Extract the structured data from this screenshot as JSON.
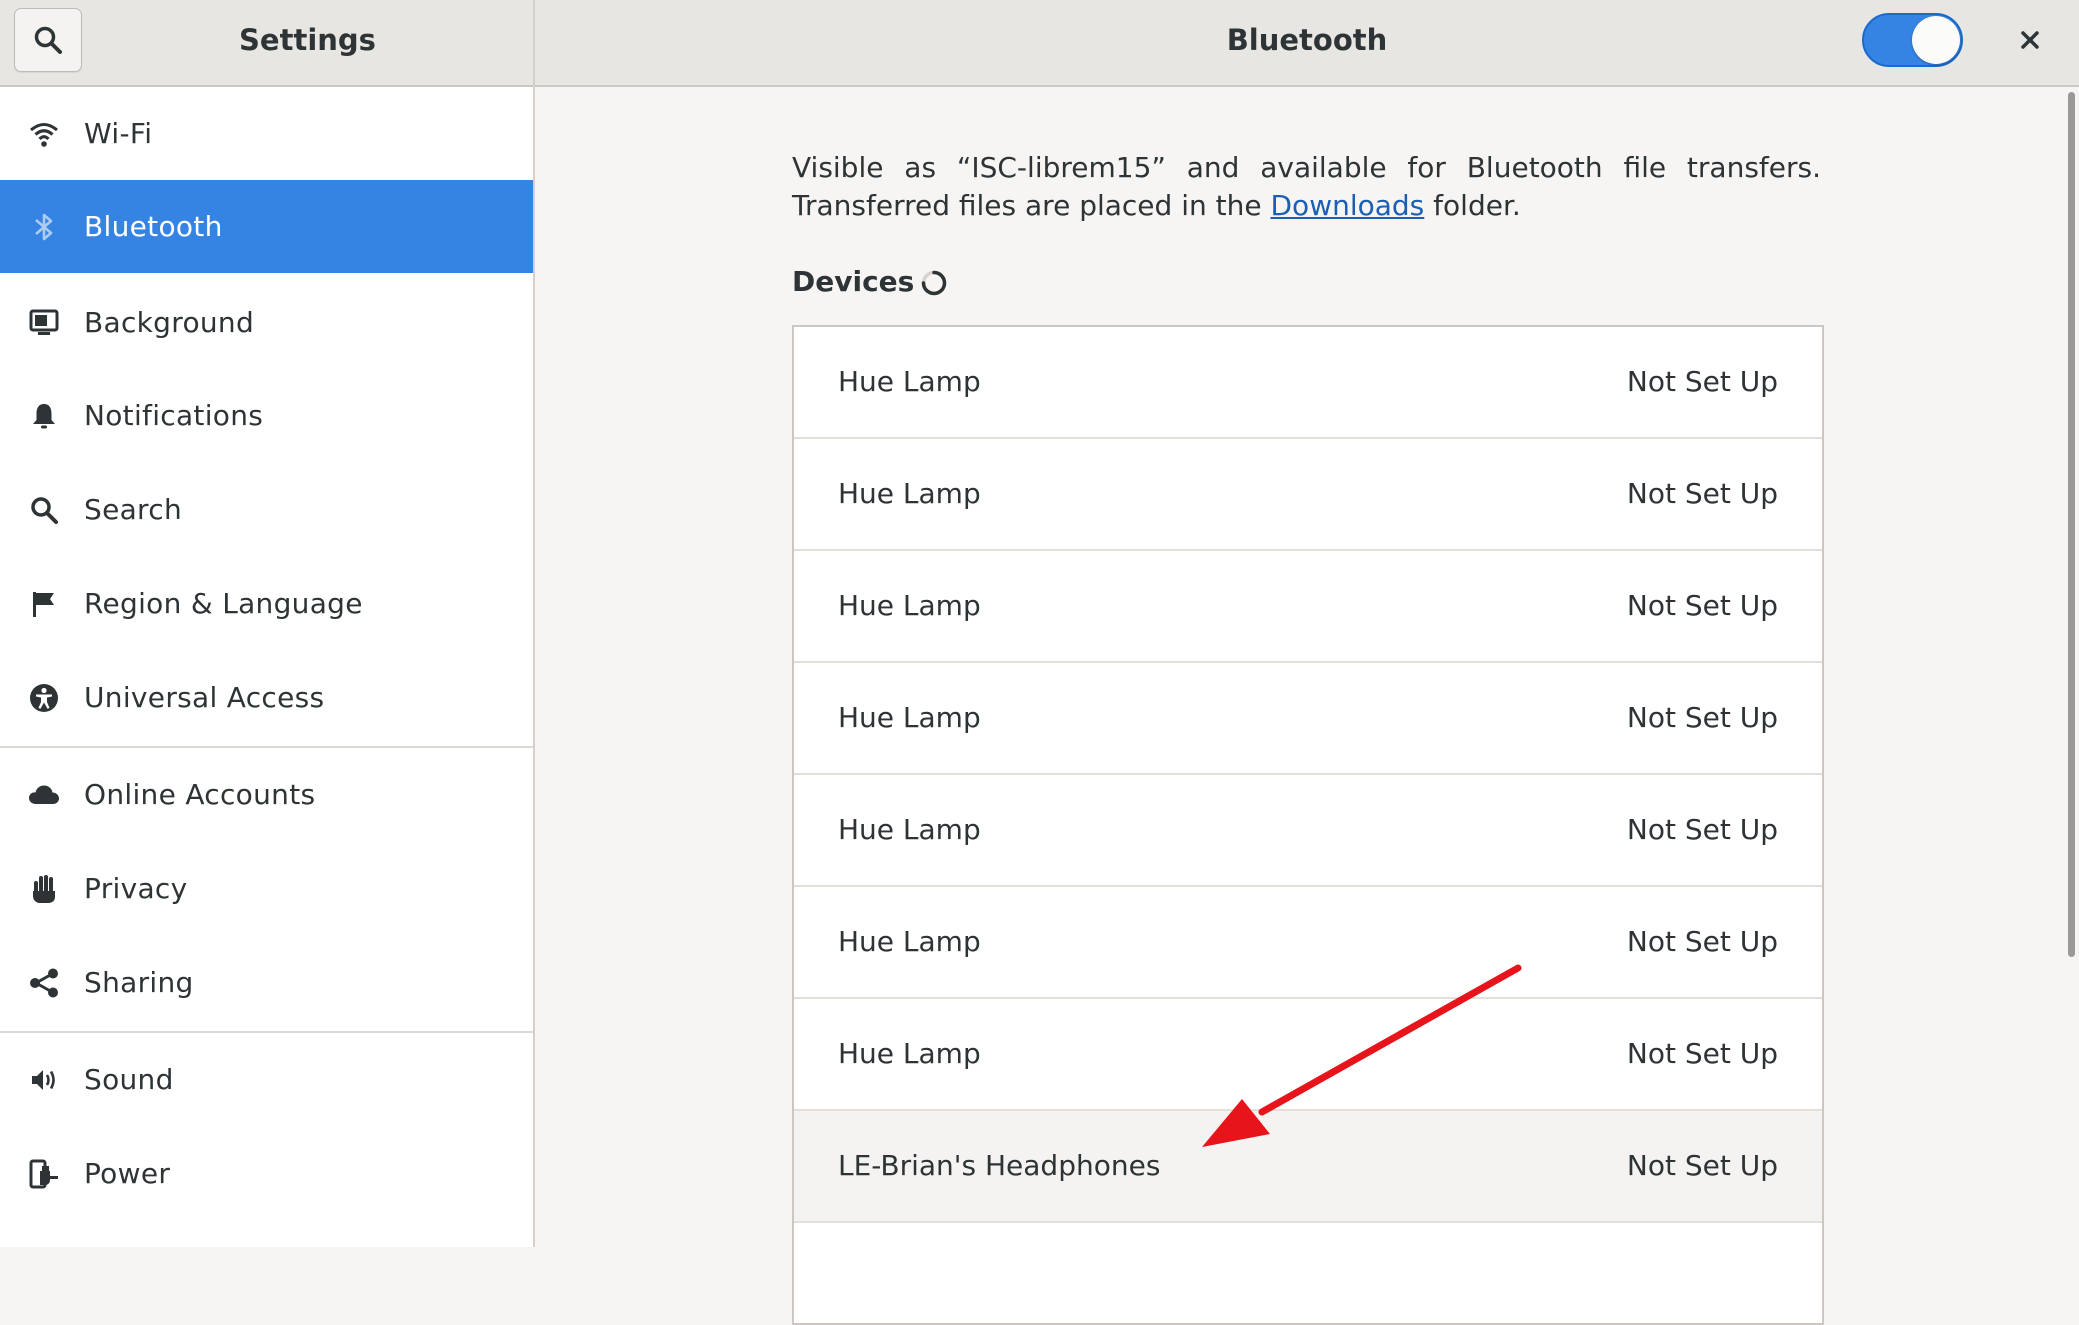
{
  "header": {
    "left_title": "Settings",
    "main_title": "Bluetooth",
    "toggle_state": "on"
  },
  "sidebar": {
    "items": [
      {
        "label": "Wi-Fi",
        "icon": "wifi-icon"
      },
      {
        "label": "Bluetooth",
        "icon": "bluetooth-icon",
        "active": true
      },
      {
        "label": "Background",
        "icon": "background-icon"
      },
      {
        "label": "Notifications",
        "icon": "bell-icon"
      },
      {
        "label": "Search",
        "icon": "search-icon"
      },
      {
        "label": "Region & Language",
        "icon": "flag-icon"
      },
      {
        "label": "Universal Access",
        "icon": "accessibility-icon"
      },
      {
        "label": "Online Accounts",
        "icon": "cloud-icon"
      },
      {
        "label": "Privacy",
        "icon": "hand-icon"
      },
      {
        "label": "Sharing",
        "icon": "share-icon"
      },
      {
        "label": "Sound",
        "icon": "speaker-icon"
      },
      {
        "label": "Power",
        "icon": "power-plug-icon"
      }
    ]
  },
  "main": {
    "description_line1": "Visible as “ISC-librem15” and available for Bluetooth file transfers.",
    "description_line2_prefix": "Transferred files are placed in the ",
    "description_link": "Downloads",
    "description_line2_suffix": " folder.",
    "devices_title": "Devices",
    "devices": [
      {
        "name": "Hue Lamp",
        "status": "Not Set Up"
      },
      {
        "name": "Hue Lamp",
        "status": "Not Set Up"
      },
      {
        "name": "Hue Lamp",
        "status": "Not Set Up"
      },
      {
        "name": "Hue Lamp",
        "status": "Not Set Up"
      },
      {
        "name": "Hue Lamp",
        "status": "Not Set Up"
      },
      {
        "name": "Hue Lamp",
        "status": "Not Set Up"
      },
      {
        "name": "Hue Lamp",
        "status": "Not Set Up"
      },
      {
        "name": "LE-Brian's Headphones",
        "status": "Not Set Up",
        "highlighted": true
      }
    ]
  },
  "colors": {
    "accent": "#3584e4",
    "annotation_arrow": "#e8141b",
    "link": "#1a5fb4"
  }
}
